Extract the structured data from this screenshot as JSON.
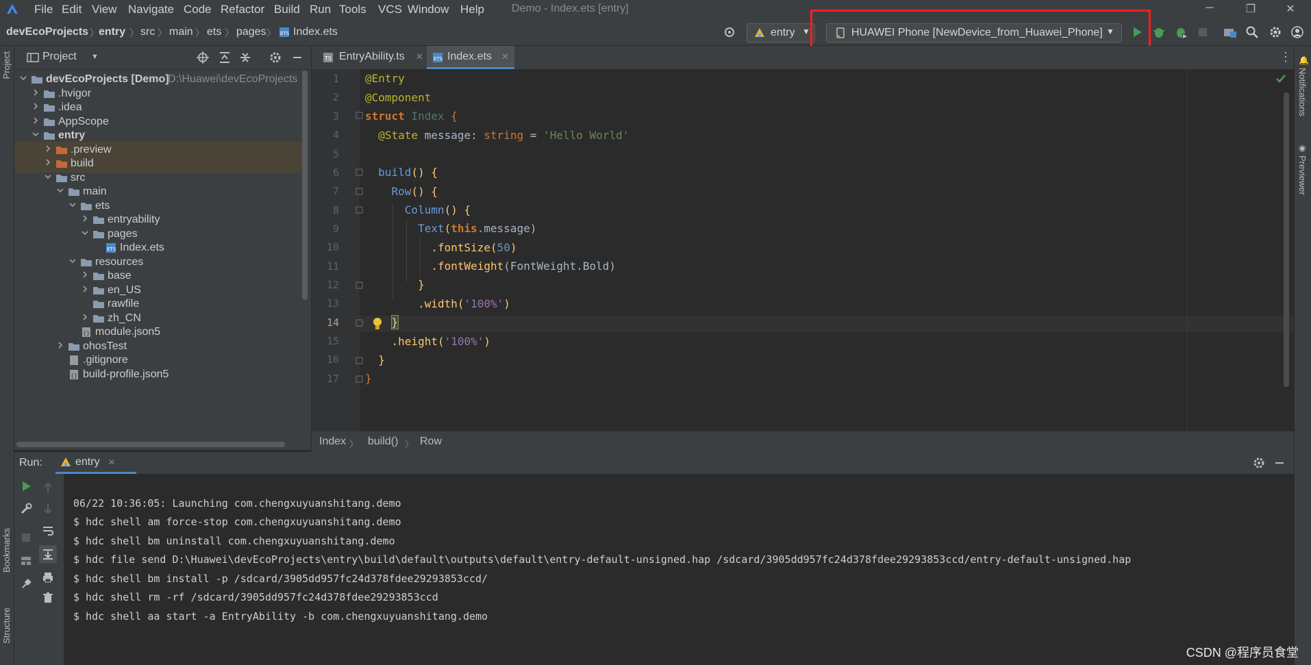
{
  "menubar": {
    "items": [
      "File",
      "Edit",
      "View",
      "Navigate",
      "Code",
      "Refactor",
      "Build",
      "Run",
      "Tools",
      "VCS",
      "Window",
      "Help"
    ],
    "window_title": "Demo - Index.ets [entry]"
  },
  "navbar": {
    "breadcrumbs": [
      "devEcoProjects",
      "entry",
      "src",
      "main",
      "ets",
      "pages",
      "Index.ets"
    ],
    "run_config": "entry",
    "device": "HUAWEI Phone [NewDevice_from_Huawei_Phone]"
  },
  "project_panel": {
    "title": "Project",
    "tree": [
      {
        "label": "devEcoProjects [Demo]",
        "extra": "D:\\Huawei\\devEcoProjects",
        "type": "folder",
        "open": true,
        "depth": 0
      },
      {
        "label": ".hvigor",
        "type": "folder",
        "open": false,
        "depth": 1
      },
      {
        "label": ".idea",
        "type": "folder",
        "open": false,
        "depth": 1
      },
      {
        "label": "AppScope",
        "type": "folder",
        "open": false,
        "depth": 1
      },
      {
        "label": "entry",
        "type": "folder",
        "open": true,
        "depth": 1
      },
      {
        "label": ".preview",
        "type": "folder-orange",
        "open": false,
        "depth": 2
      },
      {
        "label": "build",
        "type": "folder-orange",
        "open": false,
        "depth": 2
      },
      {
        "label": "src",
        "type": "folder",
        "open": true,
        "depth": 2
      },
      {
        "label": "main",
        "type": "folder",
        "open": true,
        "depth": 3
      },
      {
        "label": "ets",
        "type": "folder",
        "open": true,
        "depth": 4
      },
      {
        "label": "entryability",
        "type": "folder",
        "open": false,
        "depth": 5
      },
      {
        "label": "pages",
        "type": "folder",
        "open": true,
        "depth": 5
      },
      {
        "label": "Index.ets",
        "type": "file-ets",
        "depth": 6
      },
      {
        "label": "resources",
        "type": "folder",
        "open": true,
        "depth": 4
      },
      {
        "label": "base",
        "type": "folder",
        "open": false,
        "depth": 5
      },
      {
        "label": "en_US",
        "type": "folder",
        "open": false,
        "depth": 5
      },
      {
        "label": "rawfile",
        "type": "folder",
        "depth": 5
      },
      {
        "label": "zh_CN",
        "type": "folder",
        "open": false,
        "depth": 5
      },
      {
        "label": "module.json5",
        "type": "file-json",
        "depth": 4
      },
      {
        "label": "ohosTest",
        "type": "folder",
        "open": false,
        "depth": 3
      },
      {
        "label": ".gitignore",
        "type": "file",
        "depth": 3
      },
      {
        "label": "build-profile.json5",
        "type": "file-json",
        "depth": 3
      }
    ]
  },
  "editor": {
    "tabs": [
      {
        "label": "EntryAbility.ts",
        "active": false
      },
      {
        "label": "Index.ets",
        "active": true
      }
    ],
    "line_numbers": [
      "1",
      "2",
      "3",
      "4",
      "5",
      "6",
      "7",
      "8",
      "9",
      "10",
      "11",
      "12",
      "13",
      "14",
      "15",
      "16",
      "17"
    ],
    "code": {
      "l1": "@Entry",
      "l2": "@Component",
      "l3_kw": "struct",
      "l3_name": "Index",
      "l3_brace": "{",
      "l4_ann": "@State",
      "l4_var": "message",
      "l4_type": "string",
      "l4_eq": "=",
      "l4_str": "'Hello World'",
      "l6_fn": "build",
      "l6_rest": "() {",
      "l7_fn": "Row",
      "l7_rest": "() {",
      "l8_fn": "Column",
      "l8_rest": "() {",
      "l9_fn": "Text",
      "l9_open": "(",
      "l9_this": "this",
      "l9_rest": ".message)",
      "l10_m": ".fontSize",
      "l10_open": "(",
      "l10_num": "50",
      "l10_close": ")",
      "l11_m": ".fontWeight",
      "l11_arg": "(FontWeight.Bold)",
      "l12": "}",
      "l13_m": ".width",
      "l13_open": "(",
      "l13_str": "'100%'",
      "l13_close": ")",
      "l14": "}",
      "l15_m": ".height",
      "l15_open": "(",
      "l15_str": "'100%'",
      "l15_close": ")",
      "l16": "}",
      "l17": "}"
    },
    "breadcrumb": [
      "Index",
      "build()",
      "Row"
    ]
  },
  "run_panel": {
    "label": "Run:",
    "tab": "entry",
    "output": [
      "06/22 10:36:05: Launching com.chengxuyuanshitang.demo",
      "$ hdc shell am force-stop com.chengxuyuanshitang.demo",
      "$ hdc shell bm uninstall com.chengxuyuanshitang.demo",
      "$ hdc file send D:\\Huawei\\devEcoProjects\\entry\\build\\default\\outputs\\default\\entry-default-unsigned.hap /sdcard/3905dd957fc24d378fdee29293853ccd/entry-default-unsigned.hap",
      "$ hdc shell bm install -p /sdcard/3905dd957fc24d378fdee29293853ccd/",
      "$ hdc shell rm -rf /sdcard/3905dd957fc24d378fdee29293853ccd",
      "$ hdc shell aa start -a EntryAbility -b com.chengxuyuanshitang.demo"
    ]
  },
  "side_labels": {
    "project": "Project",
    "bookmarks": "Bookmarks",
    "structure": "Structure",
    "notifications": "Notifications",
    "previewer": "Previewer"
  },
  "watermark": "CSDN @程序员食堂",
  "colors": {
    "annotation_box": "#ff1f1f",
    "run_green": "#499c54",
    "accent": "#4a88c7"
  }
}
